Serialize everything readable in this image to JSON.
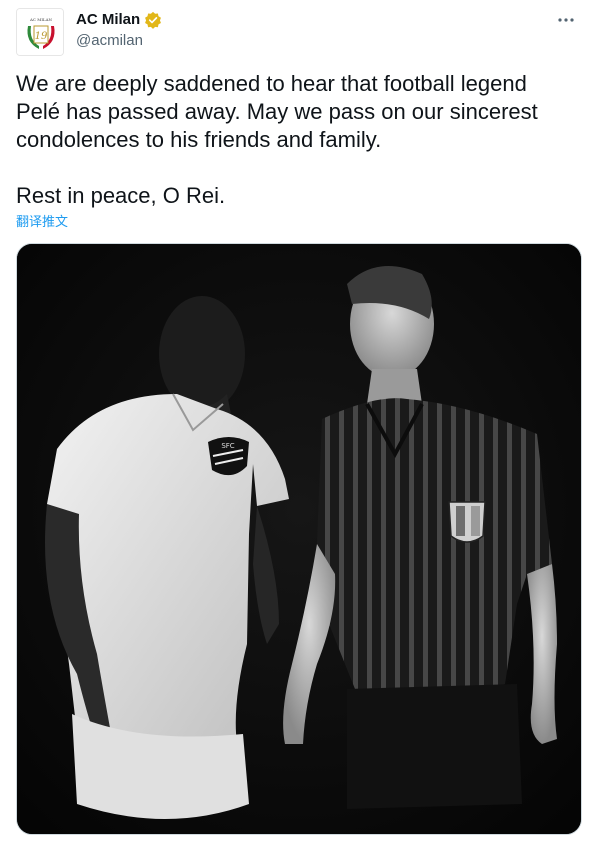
{
  "tweet": {
    "display_name": "AC Milan",
    "handle": "@acmilan",
    "text": "We are deeply saddened to hear that football legend Pelé has passed away. May we pass on our sincerest condolences to his friends and family.\n\nRest in peace, O Rei.",
    "translate_label": "翻译推文",
    "avatar_logo_text": "AC MILAN",
    "avatar_number": "19",
    "verified_badge_icon": "verified-gold-badge-icon",
    "more_icon": "more-options-icon",
    "crest_text": "SFC"
  },
  "colors": {
    "handle": "#536471",
    "link": "#1d9bf0",
    "verified_badge": "#e2b719"
  }
}
